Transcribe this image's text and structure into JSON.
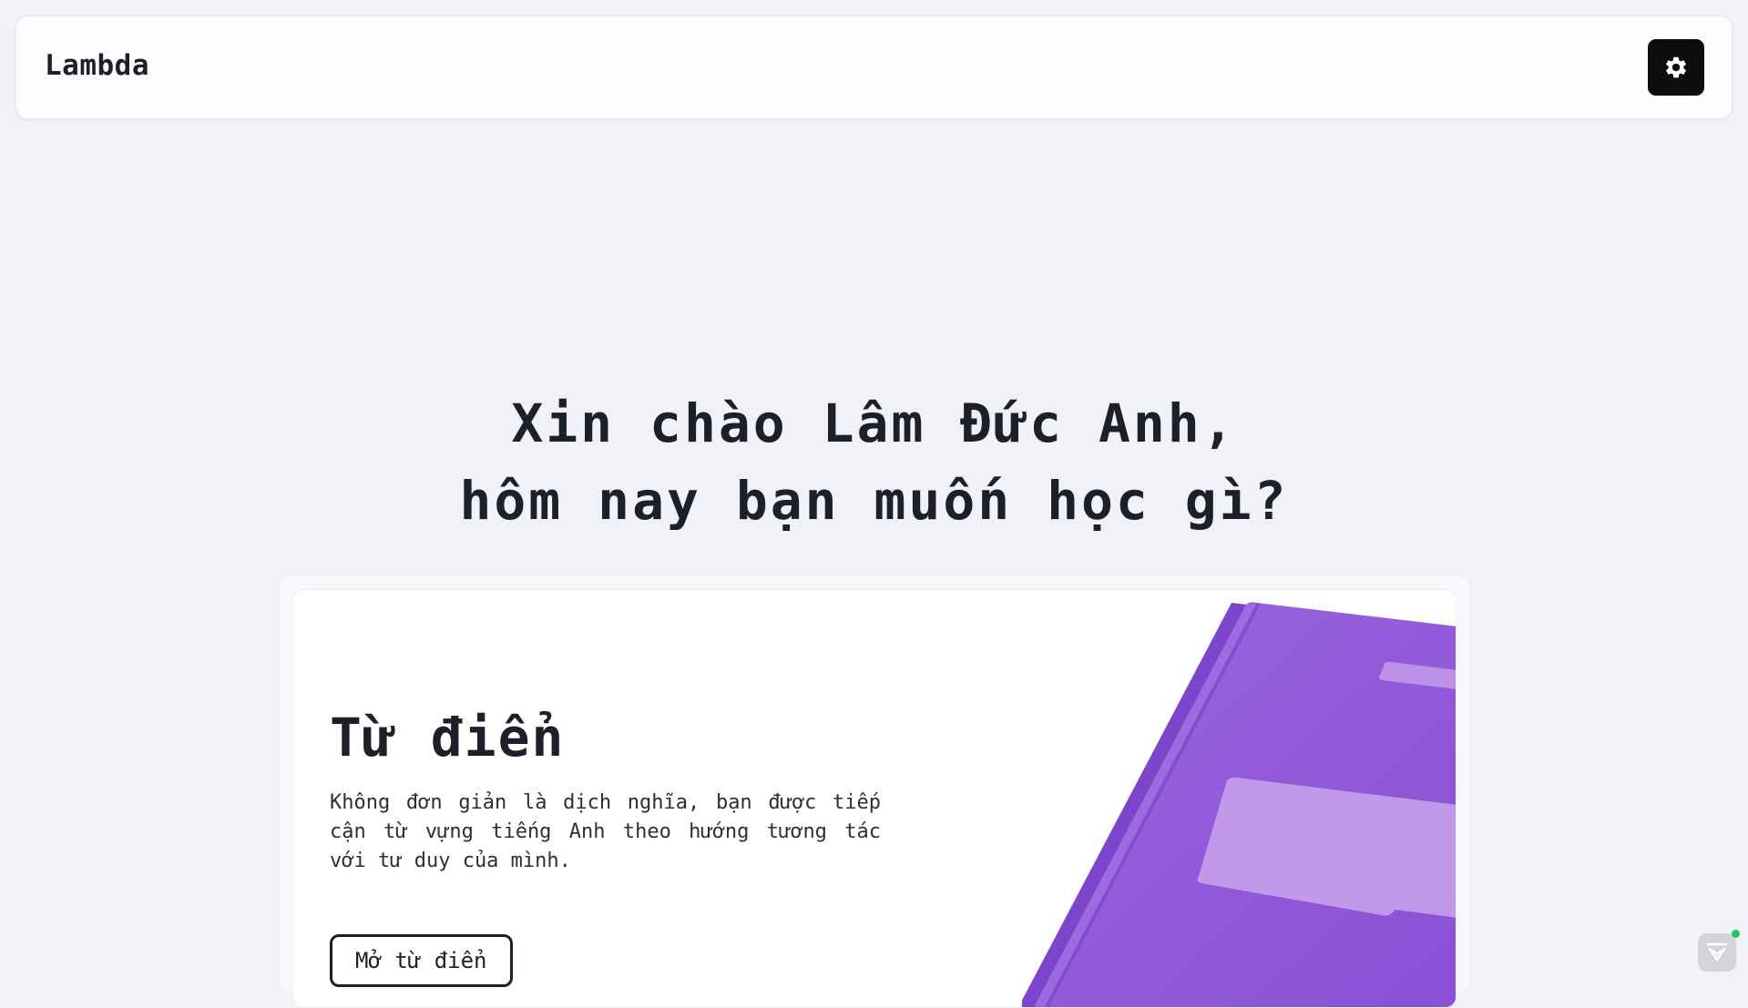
{
  "header": {
    "brand": "Lambda",
    "settings_icon": "gear-icon"
  },
  "hero": {
    "line1": "Xin chào Lâm Đức Anh,",
    "line2": "hôm nay bạn muốn học gì?"
  },
  "dictionary_card": {
    "title": "Từ điển",
    "description": "Không đơn giản là dịch nghĩa, bạn được tiếp cận từ vựng tiếng Anh theo hướng tương tác với tư duy của mình.",
    "button_label": "Mở từ điển",
    "illustration": "book-illustration",
    "accent_color": "#9157d8"
  },
  "floating_widget": {
    "icon": "chat-check-icon",
    "status_color": "#22c55e"
  }
}
